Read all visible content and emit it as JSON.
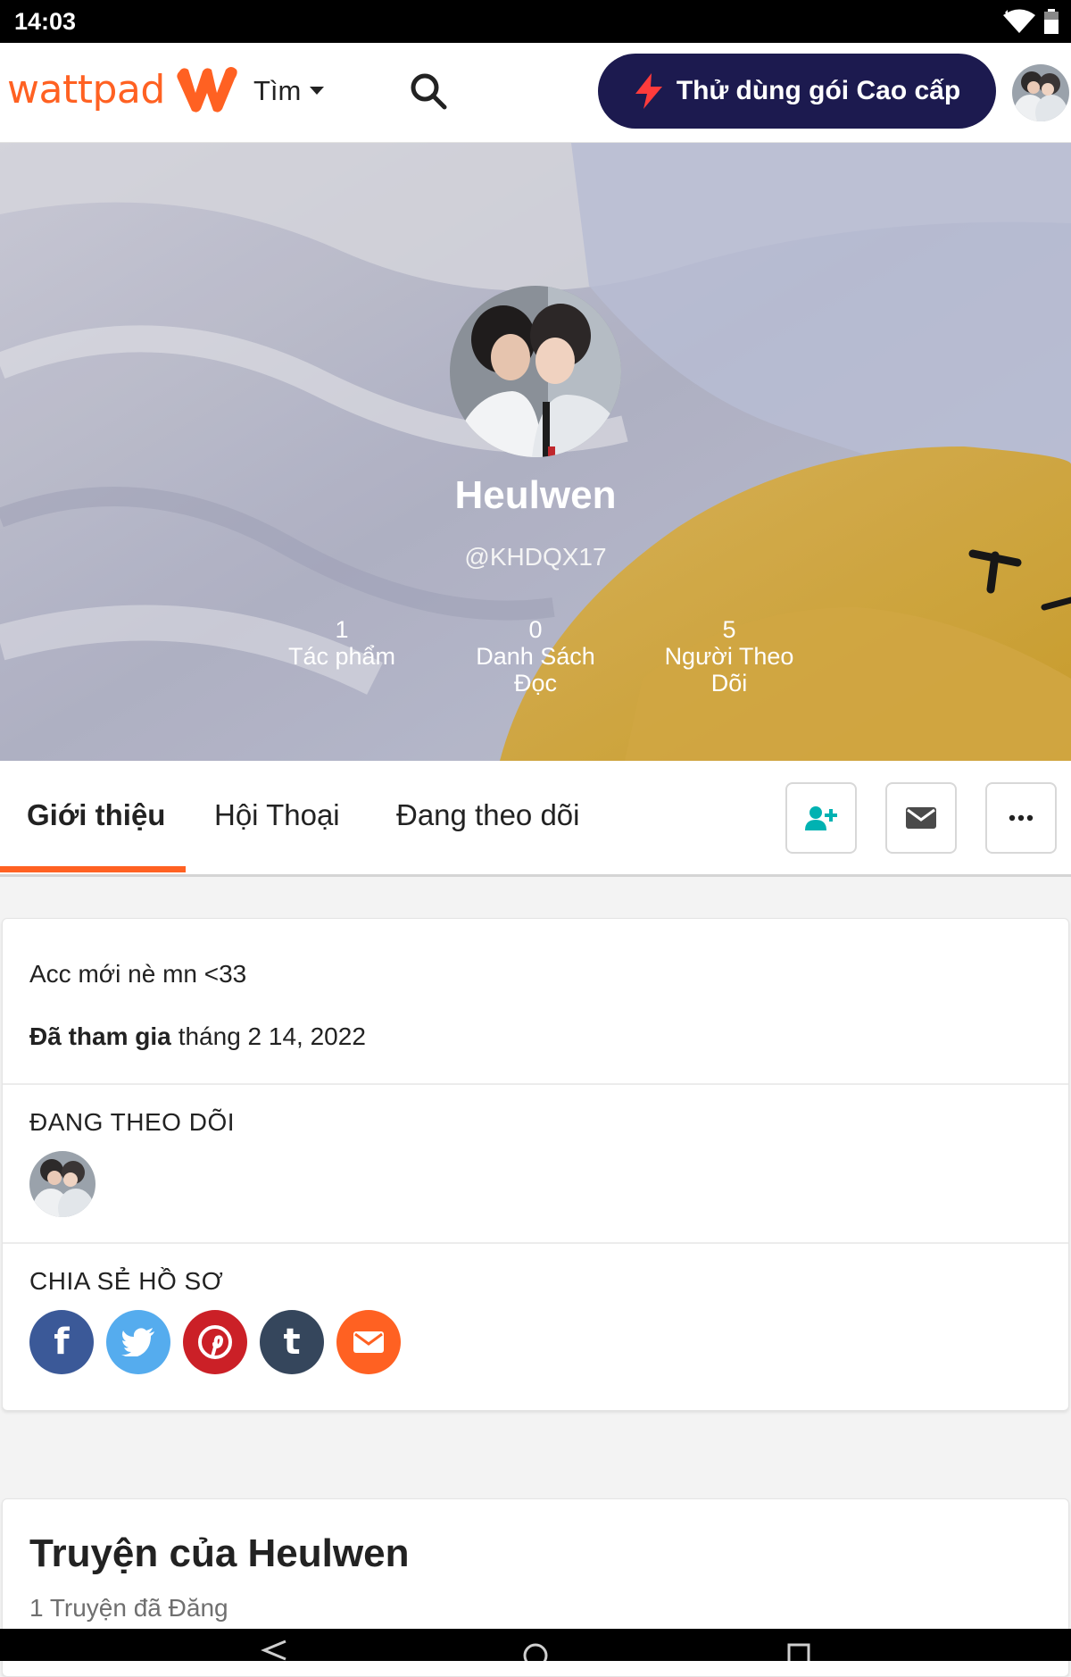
{
  "status_bar": {
    "time": "14:03"
  },
  "nav": {
    "logo_text": "wattpad",
    "search_dropdown_label": "Tìm",
    "premium_button_label": "Thử dùng gói Cao cấp"
  },
  "profile": {
    "display_name": "Heulwen",
    "handle": "@KHDQX17",
    "stats": [
      {
        "value": "1",
        "label": "Tác phẩm"
      },
      {
        "value": "0",
        "label": "Danh Sách Đọc"
      },
      {
        "value": "5",
        "label": "Người Theo Dõi"
      }
    ]
  },
  "tabs": [
    {
      "label": "Giới thiệu",
      "active": true
    },
    {
      "label": "Hội Thoại",
      "active": false
    },
    {
      "label": "Đang theo dõi",
      "active": false
    }
  ],
  "actions": {
    "follow_icon": "add-user-icon",
    "message_icon": "mail-icon",
    "more_icon": "more-icon"
  },
  "about": {
    "bio": "Acc mới nè mn <33",
    "joined_label": "Đã tham gia",
    "joined_date": "tháng 2 14, 2022",
    "following_heading": "ĐANG THEO DÕI",
    "share_heading": "CHIA SẺ HỒ SƠ",
    "share_buttons": [
      {
        "name": "facebook",
        "glyph": "f",
        "color": "#3b5998"
      },
      {
        "name": "twitter",
        "glyph": "",
        "color": "#55acee"
      },
      {
        "name": "pinterest",
        "glyph": "",
        "color": "#cb2027"
      },
      {
        "name": "tumblr",
        "glyph": "t",
        "color": "#35465c"
      },
      {
        "name": "email",
        "glyph": "",
        "color": "#ff6122"
      }
    ]
  },
  "stories": {
    "title": "Truyện của Heulwen",
    "count_text": "1 Truyện đã Đăng"
  },
  "colors": {
    "brand_orange": "#ff6122",
    "premium_navy": "#1c1a4f",
    "teal_icon": "#00b2b2"
  }
}
